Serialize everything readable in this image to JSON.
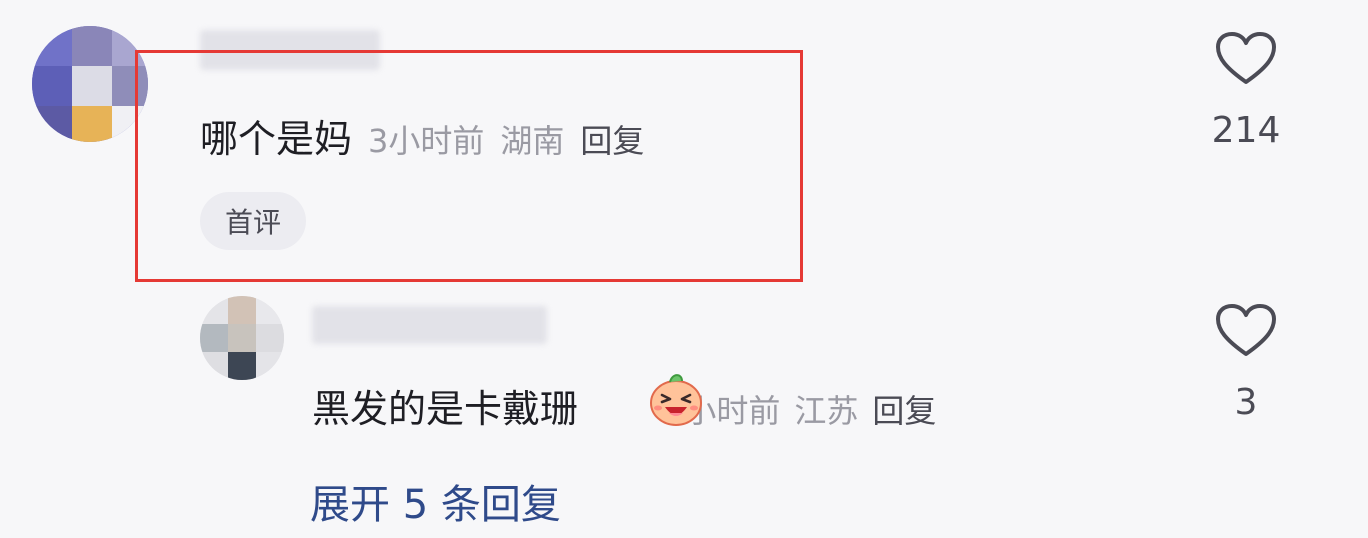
{
  "comment": {
    "text": "哪个是妈",
    "time": "3小时前",
    "location": "湖南",
    "reply_label": "回复",
    "badge": "首评",
    "likes": "214"
  },
  "reply": {
    "text": "黑发的是卡戴珊",
    "emoji": "laughing-emoji",
    "time": "2小时前",
    "location": "江苏",
    "reply_label": "回复",
    "likes": "3"
  },
  "expand_label": "展开 5 条回复",
  "colors": {
    "highlight_border": "#e53935",
    "expand_link": "#2f4a8a",
    "meta_text": "#9a9aa3"
  }
}
